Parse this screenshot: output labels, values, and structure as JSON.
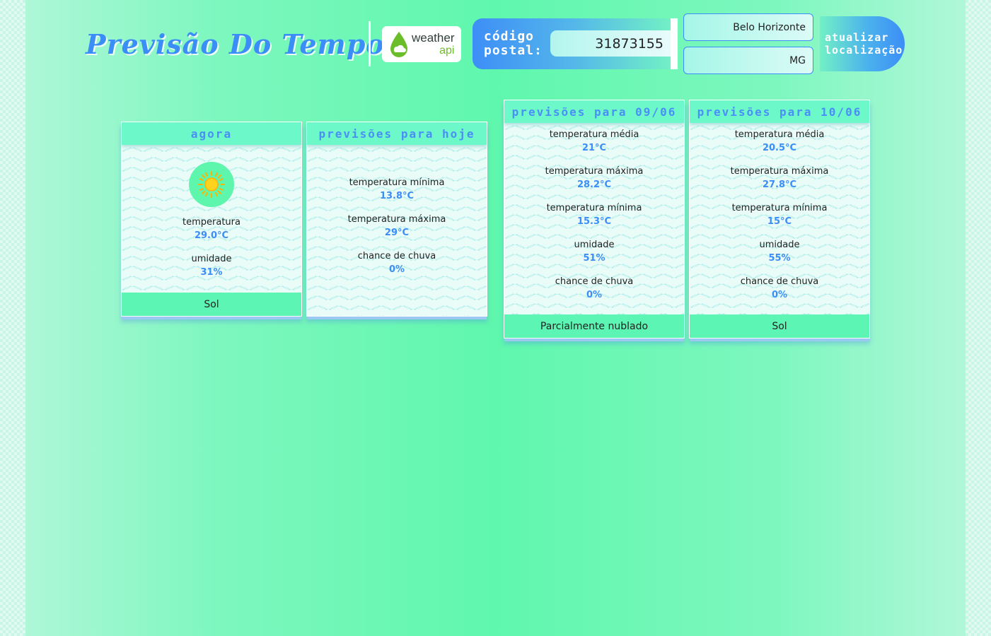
{
  "header": {
    "title": "Previsão Do Tempo",
    "logo": {
      "line1": "weather",
      "line2": "api"
    }
  },
  "search": {
    "postal_label_1": "código",
    "postal_label_2": "postal:",
    "postal_code": "31873155",
    "city": "Belo Horizonte",
    "state": "MG",
    "update_label_1": "atualizar",
    "update_label_2": "localização"
  },
  "cards": {
    "now": {
      "title": "agora",
      "icon": "sun-icon",
      "temperature_label": "temperatura",
      "temperature_value": "29.0°C",
      "humidity_label": "umidade",
      "humidity_value": "31%",
      "condition": "Sol"
    },
    "today": {
      "title": "previsões para hoje",
      "min_label": "temperatura mínima",
      "min_value": "13.8°C",
      "max_label": "temperatura máxima",
      "max_value": "29°C",
      "rain_label": "chance de chuva",
      "rain_value": "0%"
    },
    "day1": {
      "title": "previsões para 09/06",
      "avg_label": "temperatura média",
      "avg_value": "21°C",
      "max_label": "temperatura máxima",
      "max_value": "28.2°C",
      "min_label": "temperatura mínima",
      "min_value": "15.3°C",
      "humidity_label": "umidade",
      "humidity_value": "51%",
      "rain_label": "chance de chuva",
      "rain_value": "0%",
      "condition": "Parcialmente nublado"
    },
    "day2": {
      "title": "previsões para 10/06",
      "avg_label": "temperatura média",
      "avg_value": "20.5°C",
      "max_label": "temperatura máxima",
      "max_value": "27.8°C",
      "min_label": "temperatura mínima",
      "min_value": "15°C",
      "humidity_label": "umidade",
      "humidity_value": "55%",
      "rain_label": "chance de chuva",
      "rain_value": "0%",
      "condition": "Sol"
    }
  },
  "colors": {
    "accent_blue": "#3b8df7",
    "header_green": "#6cf8c9",
    "footer_green": "#5cf5b4",
    "sun_yellow": "#ffd21f"
  }
}
